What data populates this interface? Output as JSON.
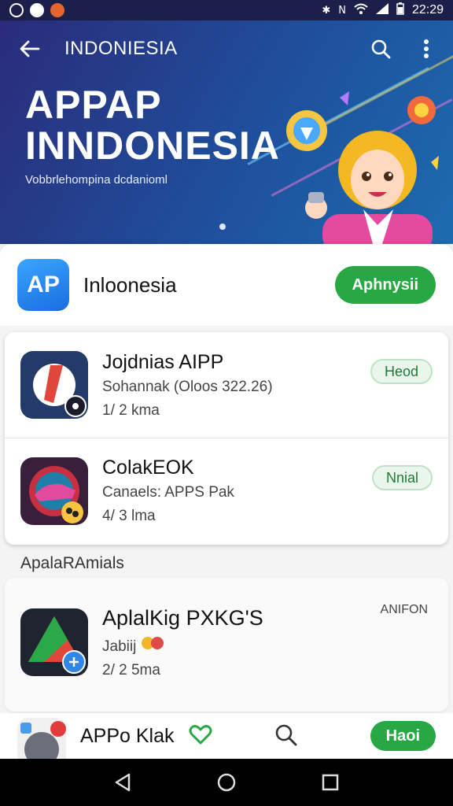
{
  "status_bar": {
    "time": "22:29",
    "icons": [
      "settings-icon",
      "media-icon",
      "notification-icon",
      "bluetooth-icon",
      "nfc-icon",
      "wifi-icon",
      "signal-icon",
      "battery-icon"
    ]
  },
  "header": {
    "title": "INDONIESIA"
  },
  "hero": {
    "title_line_1": "APPAP",
    "title_line_2": "INNDONESIA",
    "subtitle": "Vobbrlehompina dcdanioml"
  },
  "featured": {
    "logo_text": "AP",
    "name": "Inloonesia",
    "button_label": "Aphnysii"
  },
  "apps": [
    {
      "name": "Jojdnias AIPP",
      "meta": "Sohannak (Oloos 322.26)",
      "stats": "1/ 2 kma",
      "button_label": "Heod"
    },
    {
      "name": "ColakEOK",
      "meta": "Canaels: APPS Pak",
      "stats": "4/ 3 lma",
      "button_label": "Nnial"
    }
  ],
  "section": {
    "label": "ApalaRAmials"
  },
  "featured_app": {
    "name": "AplalKig PXKG'S",
    "meta": "Jabiij",
    "stats": "2/ 2 5ma",
    "tag": "ANIFON"
  },
  "bottom_app": {
    "name": "APPo Klak",
    "button_label": "Haoi"
  },
  "colors": {
    "accent_green": "#27a844",
    "hero_start": "#2a2b7a",
    "hero_end": "#1d6bb0",
    "logo_blue": "#1b6de0"
  }
}
